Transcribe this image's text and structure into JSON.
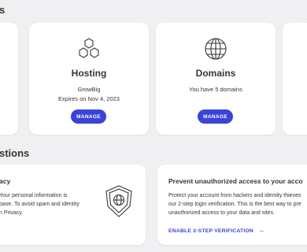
{
  "page": {
    "top_heading_fragment": "s",
    "suggestions_heading_fragment": "stions"
  },
  "services": {
    "hosting": {
      "title": "Hosting",
      "plan": "GrowBig",
      "expires": "Expires on Nov 4, 2023",
      "button": "MANAGE"
    },
    "domains": {
      "title": "Domains",
      "info": "You have 5 domains",
      "button": "MANAGE"
    }
  },
  "suggestions": {
    "privacy": {
      "title_fragment": "acy",
      "lines": [
        "Your personal information is",
        "base. To avoid spam and identity",
        "n Privacy."
      ]
    },
    "twofa": {
      "title": "Prevent unauthorized access to your acco",
      "lines": [
        "Protect your account from hackers and identity thieves",
        "our 2-step login verification. This is the best way to pre",
        "unauthorized access to your data and sites."
      ],
      "link": "ENABLE 2-STEP VERIFICATION",
      "link_arrow": "→"
    }
  },
  "colors": {
    "accent": "#3b43d8",
    "background": "#f0f0f3",
    "card": "#ffffff"
  },
  "icons": {
    "hosting": "hexagon-cluster-icon",
    "domains": "globe-icon",
    "privacy": "shield-globe-icon"
  }
}
